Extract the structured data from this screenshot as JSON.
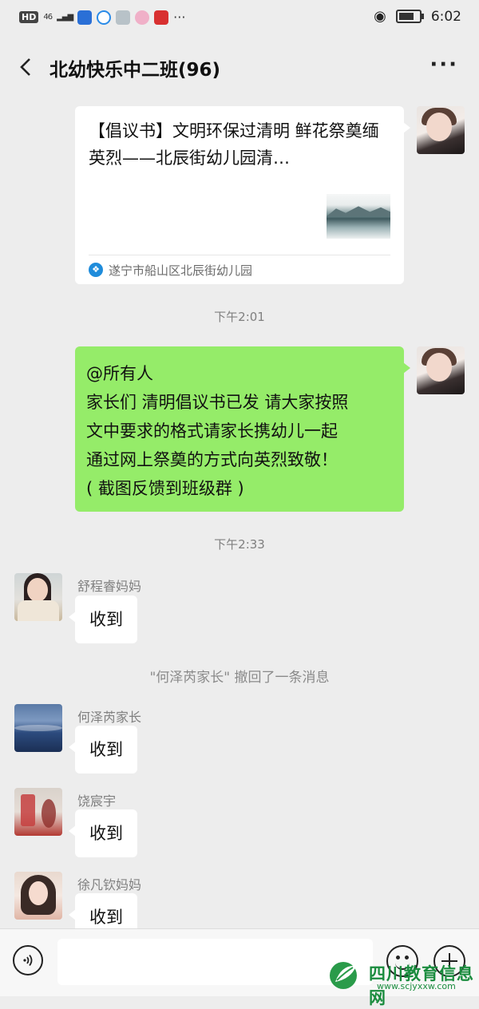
{
  "status_bar": {
    "hd": "HD",
    "signal": "46",
    "time": "6:02"
  },
  "header": {
    "title": "北幼快乐中二班(96)"
  },
  "link_card": {
    "title": "【倡议书】文明环保过清明 鲜花祭奠缅英烈——北辰街幼儿园清…",
    "source": "遂宁市船山区北辰街幼儿园"
  },
  "times": [
    "下午2:01",
    "下午2:33"
  ],
  "my_message": {
    "lines": [
      "@所有人",
      "家长们 清明倡议书已发 请大家按照",
      "文中要求的格式请家长携幼儿一起",
      "通过网上祭奠的方式向英烈致敬！",
      "( 截图反馈到班级群 )"
    ]
  },
  "system_message": "\"何泽芮家长\" 撤回了一条消息",
  "incoming": [
    {
      "sender": "舒程睿妈妈",
      "text": "收到"
    },
    {
      "sender": "何泽芮家长",
      "text": "收到"
    },
    {
      "sender": "饶宸宇",
      "text": "收到"
    },
    {
      "sender": "徐凡钦妈妈",
      "text": "收到"
    }
  ],
  "input": {
    "placeholder": ""
  },
  "watermark": {
    "name": "四川教育信息网",
    "url": "www.scjyxxw.com"
  }
}
